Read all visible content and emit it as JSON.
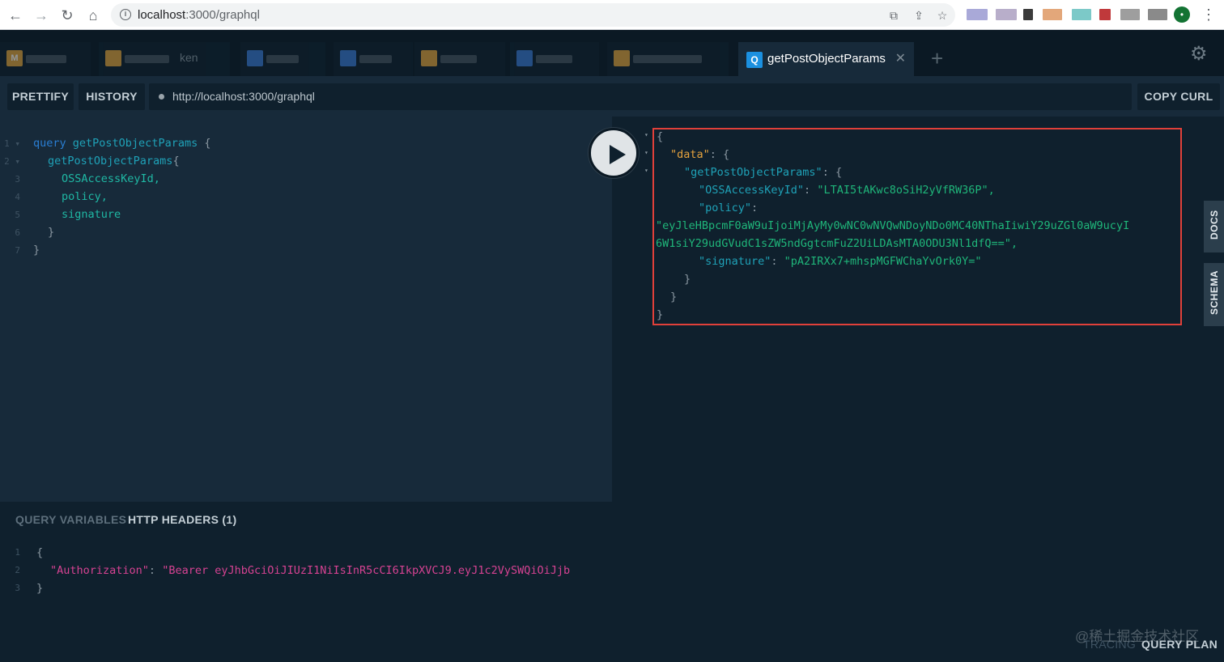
{
  "browser": {
    "url_host": "localhost",
    "url_rest": ":3000/graphql"
  },
  "tabs": {
    "partial_tab_text": "ken",
    "active_tab_icon": "Q",
    "active_tab_name": "getPostObjectParams",
    "close_glyph": "✕",
    "add_glyph": "+",
    "first_tab_letter": "M"
  },
  "toolbar": {
    "prettify": "PRETTIFY",
    "history": "HISTORY",
    "endpoint": "http://localhost:3000/graphql",
    "copy_curl": "COPY CURL"
  },
  "query": {
    "keyword": "query",
    "operation_name": "getPostObjectParams",
    "field": "getPostObjectParams",
    "subfields": [
      "OSSAccessKeyId,",
      "policy,",
      "signature"
    ]
  },
  "bottom_panel": {
    "tab_variables": "QUERY VARIABLES",
    "tab_headers": "HTTP HEADERS (1)",
    "header_key": "\"Authorization\"",
    "header_value": "\"Bearer eyJhbGciOiJIUzI1NiIsInR5cCI6IkpXVCJ9.eyJ1c2VySWQiOiJjb"
  },
  "result": {
    "data_key": "\"data\"",
    "params_key": "\"getPostObjectParams\"",
    "ossaccesskeyid_key": "\"OSSAccessKeyId\"",
    "ossaccesskeyid_value": "\"LTAI5tAKwc8oSiH2yVfRW36P\",",
    "policy_key": "\"policy\"",
    "policy_value_line1": "\"eyJleHBpcmF0aW9uIjoiMjAyMy0wNC0wNVQwNDoyNDo0MC40NThaIiwiY29uZGl0aW9ucyI",
    "policy_value_line2": "6W1siY29udGVudC1sZW5ndGgtcmFuZ2UiLDAsMTA0ODU3Nl1dfQ==\",",
    "signature_key": "\"signature\"",
    "signature_value": "\"pA2IRXx7+mhspMGFWChaYvOrk0Y=\""
  },
  "side_tabs": {
    "docs": "DOCS",
    "schema": "SCHEMA"
  },
  "footer": {
    "tracing": "TRACING",
    "query_plan": "QUERY PLAN",
    "watermark": "@稀土掘金技术社区"
  },
  "colors": {
    "highlight_border": "#e0403a",
    "string": "#1fb67a",
    "key": "#e6a33e"
  }
}
